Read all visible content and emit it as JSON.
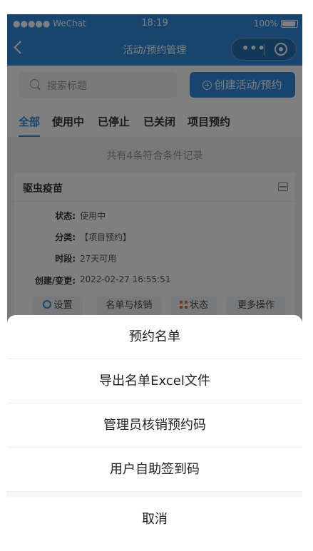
{
  "status_bar": {
    "carrier": "●●●●● WeChat",
    "time": "18:19",
    "battery": "100%"
  },
  "nav": {
    "title": "活动/预约管理",
    "more_icon": "more-dots-icon",
    "close_icon": "target-icon"
  },
  "search": {
    "placeholder": "搜索标题",
    "create_label": "创建活动/预约"
  },
  "tabs": [
    {
      "label": "全部",
      "active": true
    },
    {
      "label": "使用中",
      "active": false
    },
    {
      "label": "已停止",
      "active": false
    },
    {
      "label": "已关闭",
      "active": false
    },
    {
      "label": "项目预约",
      "active": false
    }
  ],
  "result_count": "共有4条符合条件记录",
  "card": {
    "title": "驱虫疫苗",
    "rows": [
      {
        "key": "状态:",
        "value": "使用中"
      },
      {
        "key": "分类:",
        "value": "【项目预约】"
      },
      {
        "key": "时段:",
        "value": "27天可用"
      },
      {
        "key": "创建/变更:",
        "value": "2022-02-27 16:55:51"
      }
    ],
    "buttons": [
      "设置",
      "名单与核销",
      "状态",
      "更多操作"
    ]
  },
  "action_sheet": {
    "items": [
      "预约名单",
      "导出名单Excel文件",
      "管理员核销预约码",
      "用户自助签到码"
    ],
    "cancel": "取消"
  },
  "colors": {
    "primary": "#2f8bdd",
    "accent_orange": "#e4703a",
    "mask": "rgba(0,0,0,0.5)"
  }
}
